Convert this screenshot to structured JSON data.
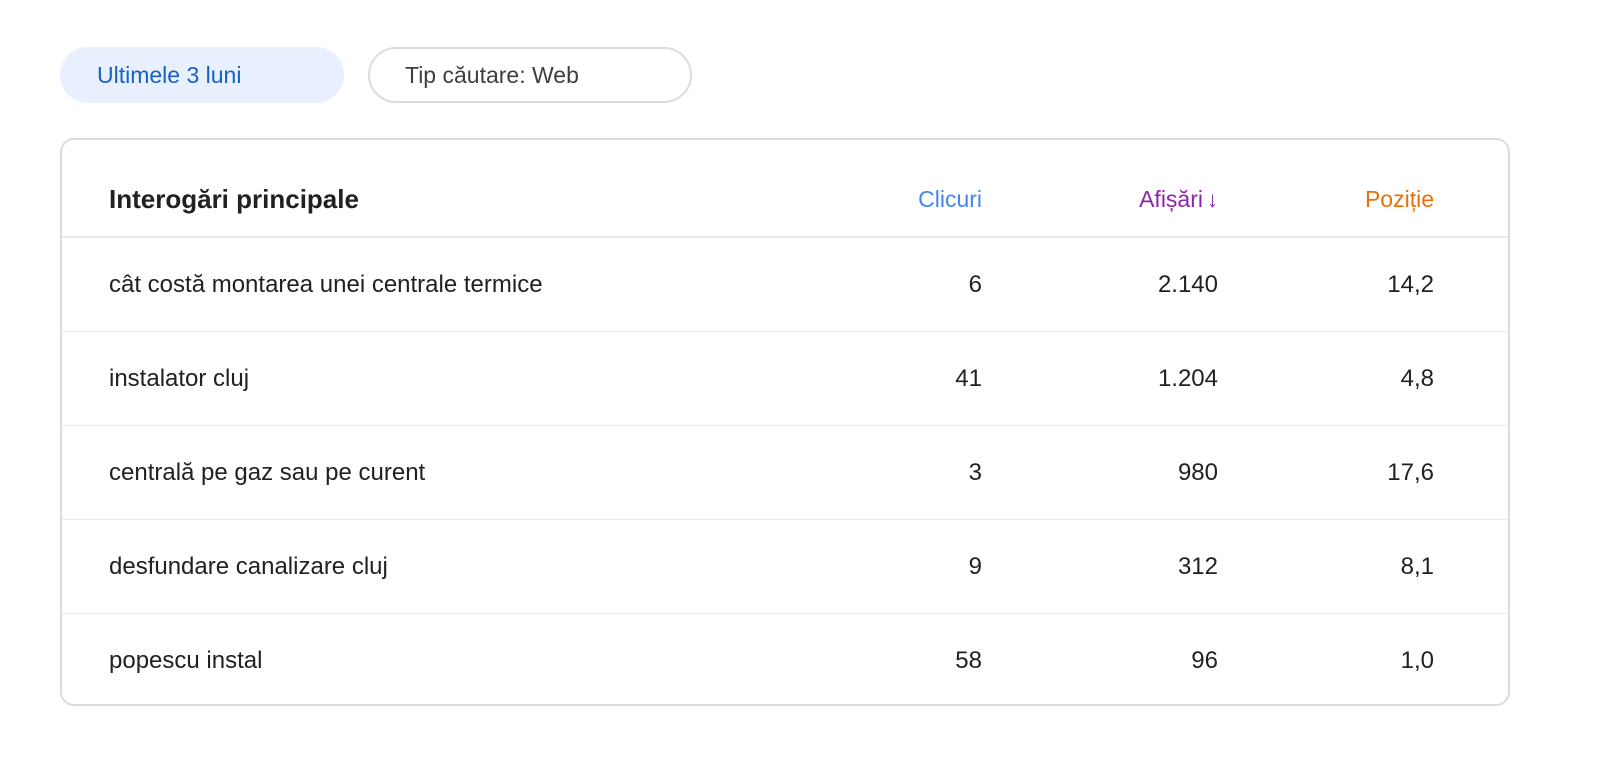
{
  "filters": {
    "date_range": "Ultimele 3 luni",
    "search_type": "Tip căutare: Web"
  },
  "table": {
    "headers": {
      "query": "Interogări principale",
      "clicks": "Clicuri",
      "impressions": "Afișări",
      "sort_arrow": "↓",
      "position": "Poziție"
    },
    "colors": {
      "clicks": "#4285f4",
      "impressions": "#8e24aa",
      "position": "#e8710a",
      "active_chip_bg": "#e8f0fe",
      "active_chip_text": "#1a5fc4"
    },
    "rows": [
      {
        "query": "cât costă montarea unei centrale termice",
        "clicks": "6",
        "impressions": "2.140",
        "position": "14,2"
      },
      {
        "query": "instalator cluj",
        "clicks": "41",
        "impressions": "1.204",
        "position": "4,8"
      },
      {
        "query": "centrală pe gaz sau pe curent",
        "clicks": "3",
        "impressions": "980",
        "position": "17,6"
      },
      {
        "query": "desfundare canalizare cluj",
        "clicks": "9",
        "impressions": "312",
        "position": "8,1"
      },
      {
        "query": "popescu instal",
        "clicks": "58",
        "impressions": "96",
        "position": "1,0"
      }
    ]
  }
}
